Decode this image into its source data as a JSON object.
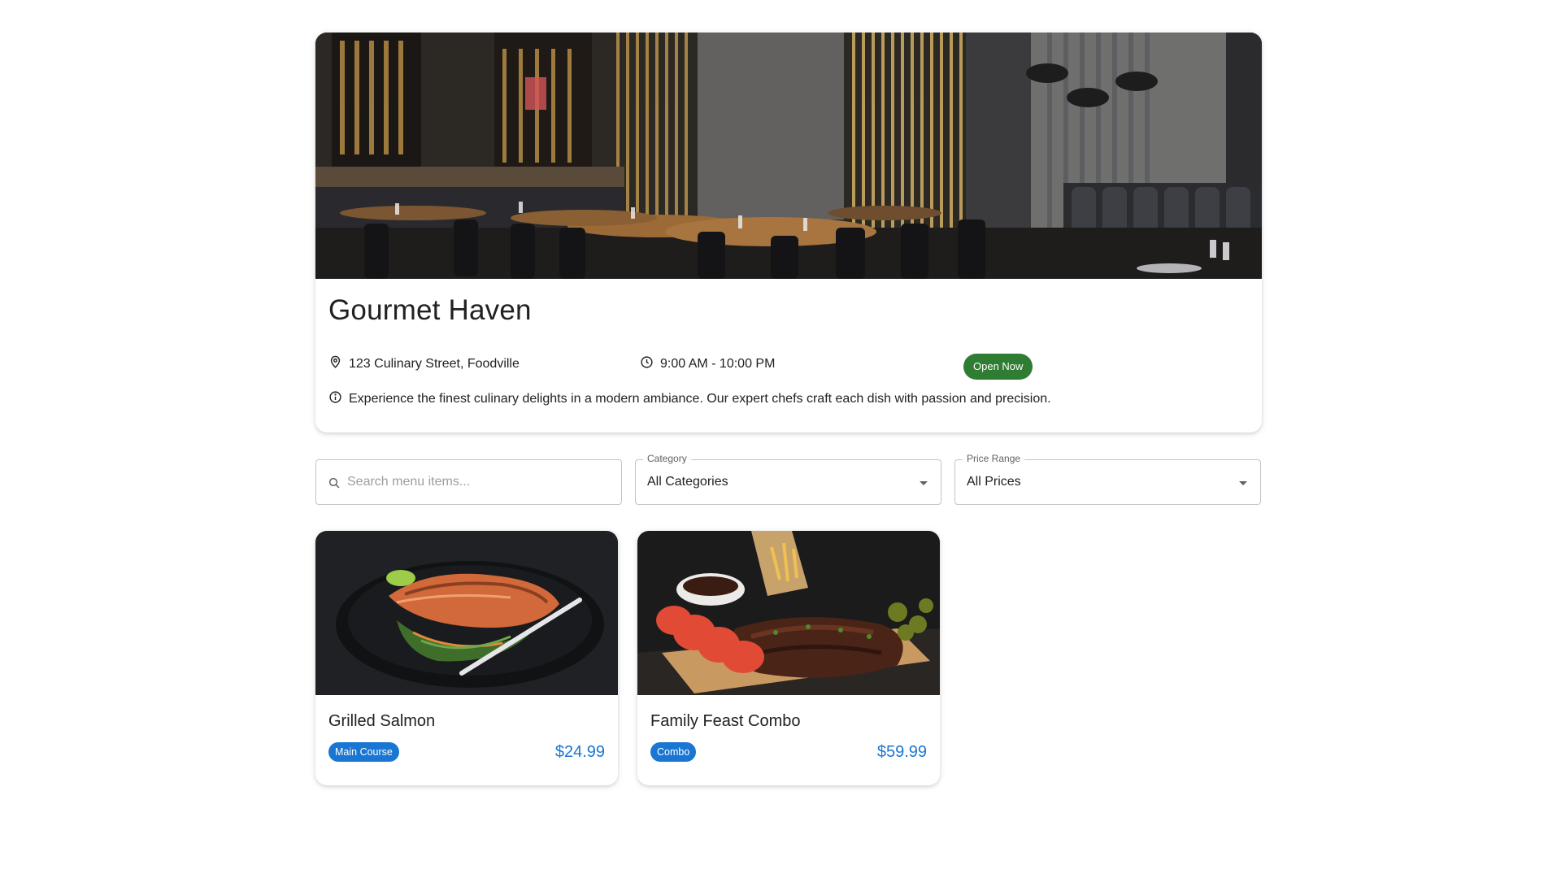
{
  "restaurant": {
    "name": "Gourmet Haven",
    "address": "123 Culinary Street, Foodville",
    "hours": "9:00 AM - 10:00 PM",
    "status": "Open Now",
    "description": "Experience the finest culinary delights in a modern ambiance. Our expert chefs craft each dish with passion and precision.",
    "hero_image": "restaurant-interior-photo"
  },
  "filters": {
    "search": {
      "placeholder": "Search menu items...",
      "value": "",
      "icon": "search-icon"
    },
    "category": {
      "label": "Category",
      "value": "All Categories"
    },
    "price_range": {
      "label": "Price Range",
      "value": "All Prices"
    }
  },
  "menu_items": [
    {
      "name": "Grilled Salmon",
      "category": "Main Course",
      "price": "$24.99",
      "image": "grilled-salmon-photo"
    },
    {
      "name": "Family Feast Combo",
      "category": "Combo",
      "price": "$59.99",
      "image": "ribs-platter-photo"
    }
  ],
  "colors": {
    "status_green": "#2e7d32",
    "chip_blue": "#1976d2",
    "price_blue": "#1976d2",
    "text": "#212121"
  }
}
